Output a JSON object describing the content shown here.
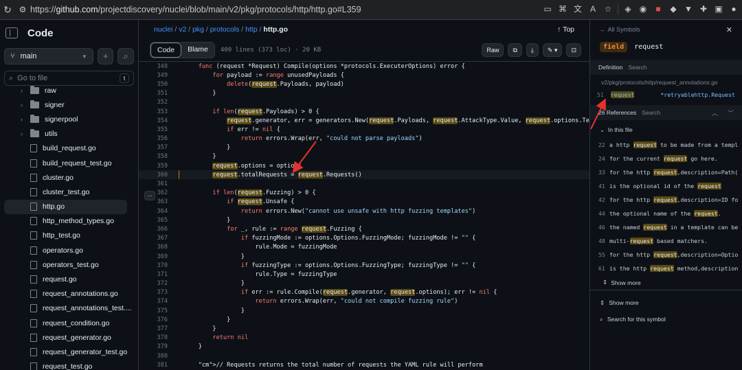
{
  "browser": {
    "url_prefix": "https://",
    "url_host": "github.com",
    "url_path": "/projectdiscovery/nuclei/blob/main/v2/pkg/protocols/http/http.go#L359"
  },
  "sidebar": {
    "title": "Code",
    "branch": "main",
    "goto_placeholder": "Go to file",
    "goto_shortcut": "t",
    "folders": [
      "raw",
      "signer",
      "signerpool",
      "utils"
    ],
    "files": [
      "build_request.go",
      "build_request_test.go",
      "cluster.go",
      "cluster_test.go",
      "http.go",
      "http_method_types.go",
      "http_test.go",
      "operators.go",
      "operators_test.go",
      "request.go",
      "request_annotations.go",
      "request_annotations_test....",
      "request_condition.go",
      "request_generator.go",
      "request_generator_test.go",
      "request_test.go"
    ]
  },
  "breadcrumb": {
    "parts": [
      "nuclei",
      "v2",
      "pkg",
      "protocols",
      "http"
    ],
    "file": "http.go",
    "separator": "/",
    "top": "Top"
  },
  "toolbar": {
    "code_tab": "Code",
    "blame_tab": "Blame",
    "stats": "400 lines (373 loc) · 20 KB",
    "raw": "Raw"
  },
  "code_lines": [
    {
      "n": "349",
      "text": "        for payload := range unusedPayloads {"
    },
    {
      "n": "350",
      "text": "            delete(request.Payloads, payload)"
    },
    {
      "n": "351",
      "text": "        }"
    },
    {
      "n": "352",
      "text": ""
    },
    {
      "n": "353",
      "text": "        if len(request.Payloads) > 0 {"
    },
    {
      "n": "354",
      "text": "            request.generator, err = generators.New(request.Payloads, request.AttackType.Value, request.options.TemplatePath,"
    },
    {
      "n": "355",
      "text": "            if err != nil {"
    },
    {
      "n": "356",
      "text": "                return errors.Wrap(err, \"could not parse payloads\")"
    },
    {
      "n": "357",
      "text": "            }"
    },
    {
      "n": "358",
      "text": "        }"
    },
    {
      "n": "359",
      "text": "        request.options = options"
    },
    {
      "n": "360",
      "text": "        request.totalRequests = request.Requests()"
    },
    {
      "n": "361",
      "text": ""
    },
    {
      "n": "362",
      "text": "        if len(request.Fuzzing) > 0 {"
    },
    {
      "n": "363",
      "text": "            if request.Unsafe {"
    },
    {
      "n": "364",
      "text": "                return errors.New(\"cannot use unsafe with http fuzzing templates\")"
    },
    {
      "n": "365",
      "text": "            }"
    },
    {
      "n": "366",
      "text": "            for _, rule := range request.Fuzzing {"
    },
    {
      "n": "367",
      "text": "                if fuzzingMode := options.Options.FuzzingMode; fuzzingMode != \"\" {"
    },
    {
      "n": "368",
      "text": "                    rule.Mode = fuzzingMode"
    },
    {
      "n": "369",
      "text": "                }"
    },
    {
      "n": "370",
      "text": "                if fuzzingType := options.Options.FuzzingType; fuzzingType != \"\" {"
    },
    {
      "n": "371",
      "text": "                    rule.Type = fuzzingType"
    },
    {
      "n": "372",
      "text": "                }"
    },
    {
      "n": "373",
      "text": "                if err := rule.Compile(request.generator, request.options); err != nil {"
    },
    {
      "n": "374",
      "text": "                    return errors.Wrap(err, \"could not compile fuzzing rule\")"
    },
    {
      "n": "375",
      "text": "                }"
    },
    {
      "n": "376",
      "text": "            }"
    },
    {
      "n": "377",
      "text": "        }"
    },
    {
      "n": "378",
      "text": "        return nil"
    },
    {
      "n": "379",
      "text": "    }"
    },
    {
      "n": "380",
      "text": ""
    },
    {
      "n": "381",
      "text": "    // Requests returns the total number of requests the YAML rule will perform"
    }
  ],
  "header_code": {
    "n": "348",
    "text": "    func (request *Request) Compile(options *protocols.ExecuterOptions) error {"
  },
  "current_line": "360",
  "symbols": {
    "back": "All Symbols",
    "kind": "field",
    "name": "request",
    "definition_label": "Definition",
    "definition_search": "Search",
    "def_path": "v2/pkg/protocols/http/request_annotations.go",
    "def_line_n": "51",
    "def_line_name": "request",
    "def_line_type": "*retryablehttp.Request",
    "refs_label": "26 References",
    "refs_search": "Search",
    "in_this_file": "In this file",
    "refs": [
      {
        "n": "22",
        "pre": "a http ",
        "post": " to be made from a templ"
      },
      {
        "n": "24",
        "pre": "for the current ",
        "post": " go here."
      },
      {
        "n": "33",
        "pre": "for the http ",
        "post": ",description=Path("
      },
      {
        "n": "41",
        "pre": "is the optional id of the ",
        "post": ""
      },
      {
        "n": "42",
        "pre": "for the http ",
        "post": ",description=ID fo"
      },
      {
        "n": "44",
        "pre": "the optional name of the ",
        "post": "."
      },
      {
        "n": "46",
        "pre": "the named ",
        "post": " in a template can be"
      },
      {
        "n": "48",
        "pre": "multi-",
        "post": " based matchers."
      },
      {
        "n": "55",
        "pre": "for the http ",
        "post": ",description=Optio"
      },
      {
        "n": "61",
        "pre": "is the http ",
        "post": " method,description"
      }
    ],
    "show_more_1": "Show more",
    "show_more_2": "Show more",
    "search_symbol": "Search for this symbol"
  },
  "colors": {
    "accent": "#4493f8",
    "highlight": "#5a4a12",
    "arrow": "#e5322d"
  }
}
